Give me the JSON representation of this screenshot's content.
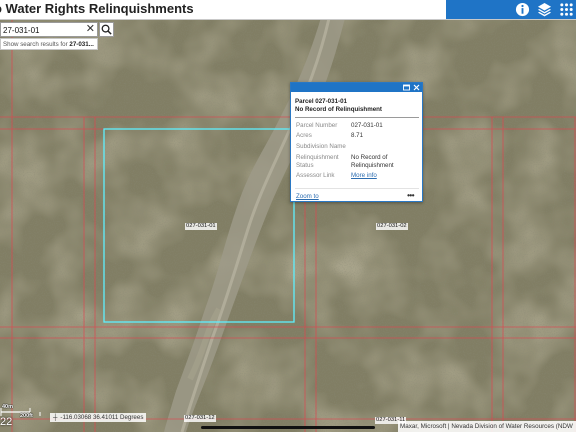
{
  "header": {
    "title": "o Water Rights Relinquishments",
    "toolbar": [
      {
        "icon": "info-icon"
      },
      {
        "icon": "layers-icon"
      },
      {
        "icon": "grid-apps-icon"
      }
    ],
    "toolbar_color": "#1f74c6"
  },
  "search": {
    "value": "27-031-01",
    "clear_label": "✕",
    "suggestion_prefix": "Show search results for ",
    "suggestion_bold": "27-031..."
  },
  "popup": {
    "title_line1": "Parcel 027-031-01",
    "title_line2": "No Record of Relinquishment",
    "attributes": [
      {
        "key": "Parcel Number",
        "value": "027-031-01"
      },
      {
        "key": "Acres",
        "value": "8.71"
      },
      {
        "key": "Subdivision Name",
        "value": ""
      },
      {
        "key": "Relinquishment Status",
        "value": "No Record of Relinquishment"
      },
      {
        "key": "Assessor Link",
        "value": "More info"
      }
    ],
    "zoom_label": "Zoom to",
    "more_label": "•••"
  },
  "map_labels": {
    "selected_parcel": "027-031-01",
    "east_parcel": "027-031-02",
    "south_parcel": "027-031-12",
    "southeast_parcel": "027-031-11"
  },
  "footer": {
    "coordinates": "-116.03068 36.41011 Degrees",
    "attribution": "Maxar, Microsoft | Nevada Division of Water Resources (NDW",
    "scale_top": "40m",
    "scale_bottom": "200ft",
    "zoom_level": "22"
  },
  "colors": {
    "parcel_line": "#e0454f",
    "selection": "#5ef0ff",
    "link": "#2b6cb0"
  }
}
